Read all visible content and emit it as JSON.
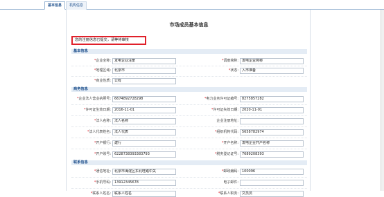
{
  "tabs": [
    {
      "label": "基本信息"
    },
    {
      "label": "机构信息"
    }
  ],
  "page_title": "市场成员基本信息",
  "notice": "您的注册信息已提交，请等待审核",
  "sections": {
    "basic": "基本信息",
    "business": "商务信息",
    "contact": "联系信息"
  },
  "fields": {
    "full_name": {
      "label": "企业全称:",
      "value": "发电企业注册",
      "required": true
    },
    "dispatch_name": {
      "label": "调度简称:",
      "value": "发电企业简称",
      "required": true
    },
    "region": {
      "label": "地理区域:",
      "value": "北京市",
      "required": true
    },
    "status": {
      "label": "状态:",
      "value": "入市准备",
      "required": true
    },
    "nature": {
      "label": "商业性质:",
      "value": "公有",
      "required": true
    },
    "license_no": {
      "label": "企业法人营业执照号:",
      "value": "6674892728298",
      "required": true
    },
    "power_license_no": {
      "label": "电力业务许可证编号:",
      "value": "8275857282",
      "required": true
    },
    "license_valid": {
      "label": "许可证生效日期:",
      "value": "2016-11-01",
      "required": true
    },
    "license_invalid": {
      "label": "许可证失效日期:",
      "value": "2020-11-01",
      "required": true
    },
    "legal_name": {
      "label": "法人名称:",
      "value": "法人名称",
      "required": true
    },
    "reg_address": {
      "label": "企业注册地址:",
      "value": "",
      "required": false
    },
    "legal_rep": {
      "label": "法人代表姓名:",
      "value": "法人代表",
      "required": true
    },
    "org_code": {
      "label": "组织机构代码:",
      "value": "5658782974",
      "required": true
    },
    "bank": {
      "label": "开户银行:",
      "value": "建行",
      "required": true
    },
    "account_name": {
      "label": "开户名称:",
      "value": "发电企业开户名称",
      "required": true
    },
    "account_no": {
      "label": "开户账号:",
      "value": "6228738393383793",
      "required": true
    },
    "tax_no": {
      "label": "税务登记证号:",
      "value": "7689208393",
      "required": true
    },
    "address": {
      "label": "通信地址:",
      "value": "北京市海淀区东北旺路中关",
      "required": true
    },
    "postcode": {
      "label": "邮政编码:",
      "value": "100096",
      "required": true
    },
    "mobile": {
      "label": "手机号码:",
      "value": "13912345678",
      "required": true
    },
    "email": {
      "label": "电子邮件:",
      "value": "",
      "required": false
    },
    "contact_name": {
      "label": "联系人姓名:",
      "value": "联系人姓名",
      "required": true
    },
    "contact_title": {
      "label": "联系人职务:",
      "value": "文员员",
      "required": true
    }
  },
  "colors": {
    "accent": "#1d4f8c",
    "section_bg": "#e4ecf5",
    "notice_border": "#e0202a",
    "required": "#e0202a"
  }
}
